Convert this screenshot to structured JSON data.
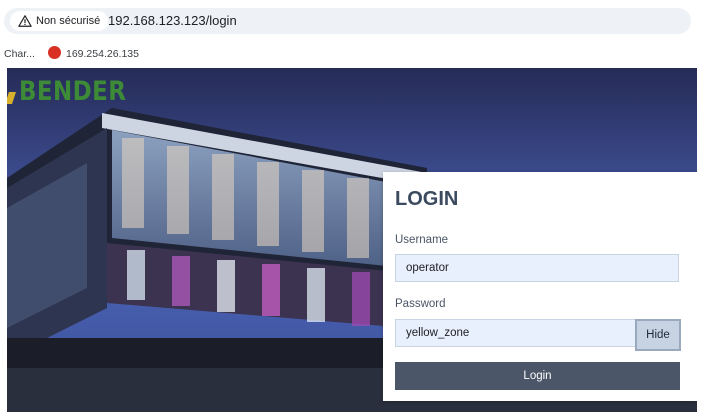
{
  "browser": {
    "security_label": "Non sécurisé",
    "url": "192.168.123.123/login",
    "bookmarks": [
      {
        "label": "Char..."
      },
      {
        "label": "169.254.26.135"
      }
    ]
  },
  "brand": {
    "name": "BENDER",
    "color": "#3d8b36"
  },
  "login": {
    "title": "LOGIN",
    "username_label": "Username",
    "username_value": "operator",
    "password_label": "Password",
    "password_value": "yellow_zone",
    "hide_label": "Hide",
    "submit_label": "Login"
  },
  "icons": {
    "security": "warning-triangle-icon",
    "bookmark": "power-icon"
  }
}
